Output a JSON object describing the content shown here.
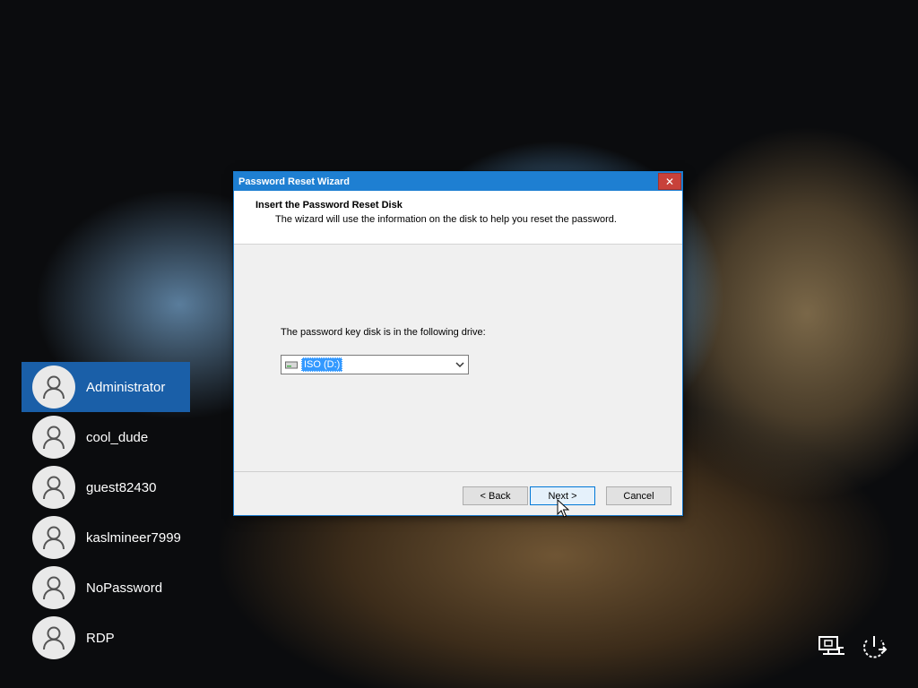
{
  "users": [
    {
      "name": "Administrator",
      "selected": true
    },
    {
      "name": "cool_dude",
      "selected": false
    },
    {
      "name": "guest82430",
      "selected": false
    },
    {
      "name": "kaslmineer7999",
      "selected": false
    },
    {
      "name": "NoPassword",
      "selected": false
    },
    {
      "name": "RDP",
      "selected": false
    }
  ],
  "dialog": {
    "title": "Password Reset Wizard",
    "close_label": "✕",
    "header_title": "Insert the Password Reset Disk",
    "header_subtitle": "The wizard will use the information on the disk to help you reset the password.",
    "drive_label": "The password key disk is in the following drive:",
    "drive_value": "ISO (D:)",
    "buttons": {
      "back": "< Back",
      "next": "Next >",
      "cancel": "Cancel"
    }
  },
  "system_icons": [
    "network-icon",
    "power-icon"
  ],
  "colors": {
    "selected_user_bg": "#1a5fa8",
    "titlebar": "#1e7fd2",
    "close_button": "#c8413a"
  }
}
